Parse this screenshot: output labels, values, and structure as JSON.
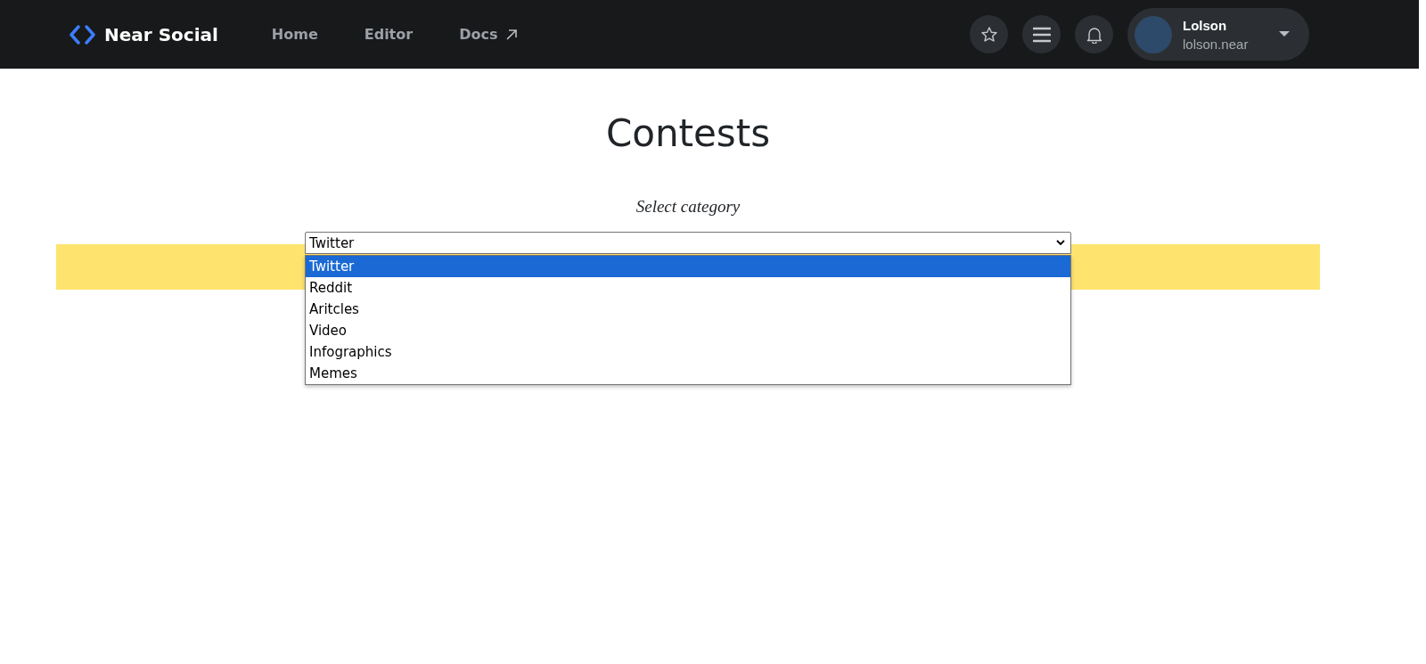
{
  "navbar": {
    "brand": "Near Social",
    "links": [
      {
        "label": "Home",
        "external": false
      },
      {
        "label": "Editor",
        "external": false
      },
      {
        "label": "Docs",
        "external": true
      }
    ],
    "user": {
      "name": "Lolson",
      "account": "lolson.near"
    }
  },
  "page": {
    "title": "Contests",
    "prompt": "Select category",
    "category_select": {
      "value": "Twitter",
      "expanded": true,
      "options": [
        {
          "label": "Twitter",
          "selected": true
        },
        {
          "label": "Reddit",
          "selected": false
        },
        {
          "label": "Aritcles",
          "selected": false
        },
        {
          "label": "Video",
          "selected": false
        },
        {
          "label": "Infographics",
          "selected": false
        },
        {
          "label": "Memes",
          "selected": false
        }
      ]
    }
  }
}
